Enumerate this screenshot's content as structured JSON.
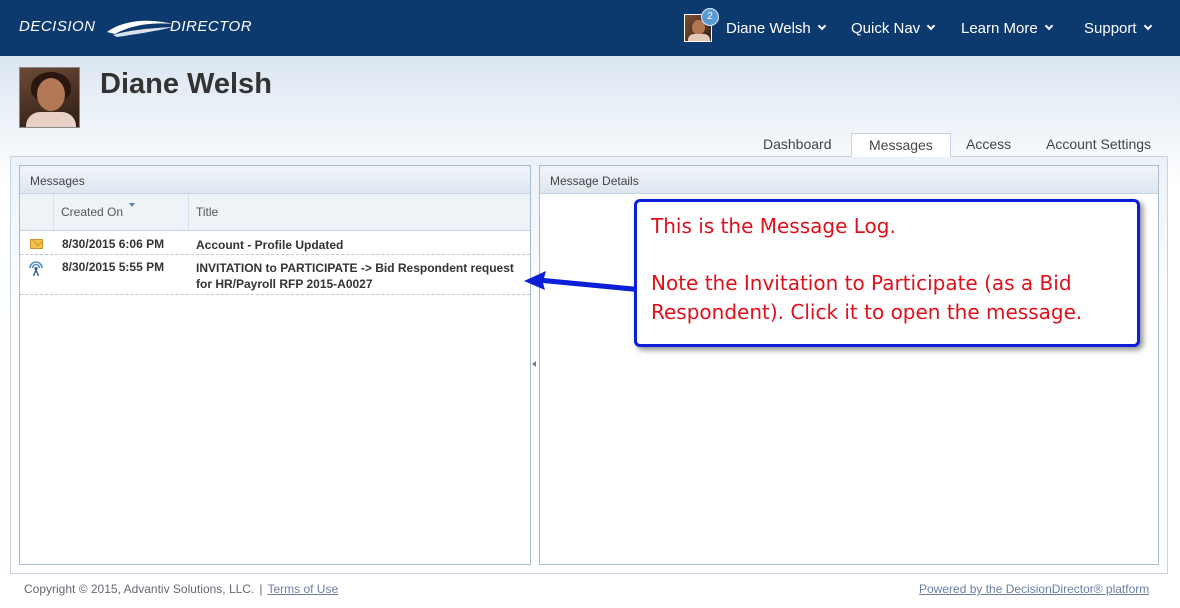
{
  "brand": {
    "word1": "DECISION",
    "word2": "DIRECTOR"
  },
  "topnav": {
    "user_name": "Diane Welsh",
    "notification_count": "2",
    "items": [
      "Quick Nav",
      "Learn More",
      "Support"
    ]
  },
  "profile": {
    "name": "Diane Welsh"
  },
  "tabs": [
    {
      "label": "Dashboard",
      "active": false
    },
    {
      "label": "Messages",
      "active": true
    },
    {
      "label": "Access",
      "active": false
    },
    {
      "label": "Account Settings",
      "active": false
    }
  ],
  "messages_panel": {
    "title": "Messages",
    "columns": [
      "Created On",
      "Title"
    ],
    "rows": [
      {
        "icon": "envelope-icon",
        "created_on": "8/30/2015 6:06 PM",
        "title": "Account - Profile Updated"
      },
      {
        "icon": "broadcast-icon",
        "created_on": "8/30/2015 5:55 PM",
        "title": "INVITATION to PARTICIPATE -> Bid Respondent request for HR/Payroll RFP 2015-A0027"
      }
    ]
  },
  "details_panel": {
    "title": "Message Details"
  },
  "callout": {
    "line1": "This is the Message Log.",
    "line2": "Note the Invitation to Participate (as a Bid Respondent). Click it to open the message.",
    "text_color": "#e0101b",
    "border_color": "#0b1fd8"
  },
  "footer": {
    "copyright": "Copyright © 2015, Advantiv Solutions, LLC.",
    "separator": "|",
    "terms": "Terms of Use",
    "powered_by": "Powered by the DecisionDirector® platform"
  },
  "colors": {
    "topbar": "#0d3a6e",
    "accent": "#5b9bd5"
  }
}
